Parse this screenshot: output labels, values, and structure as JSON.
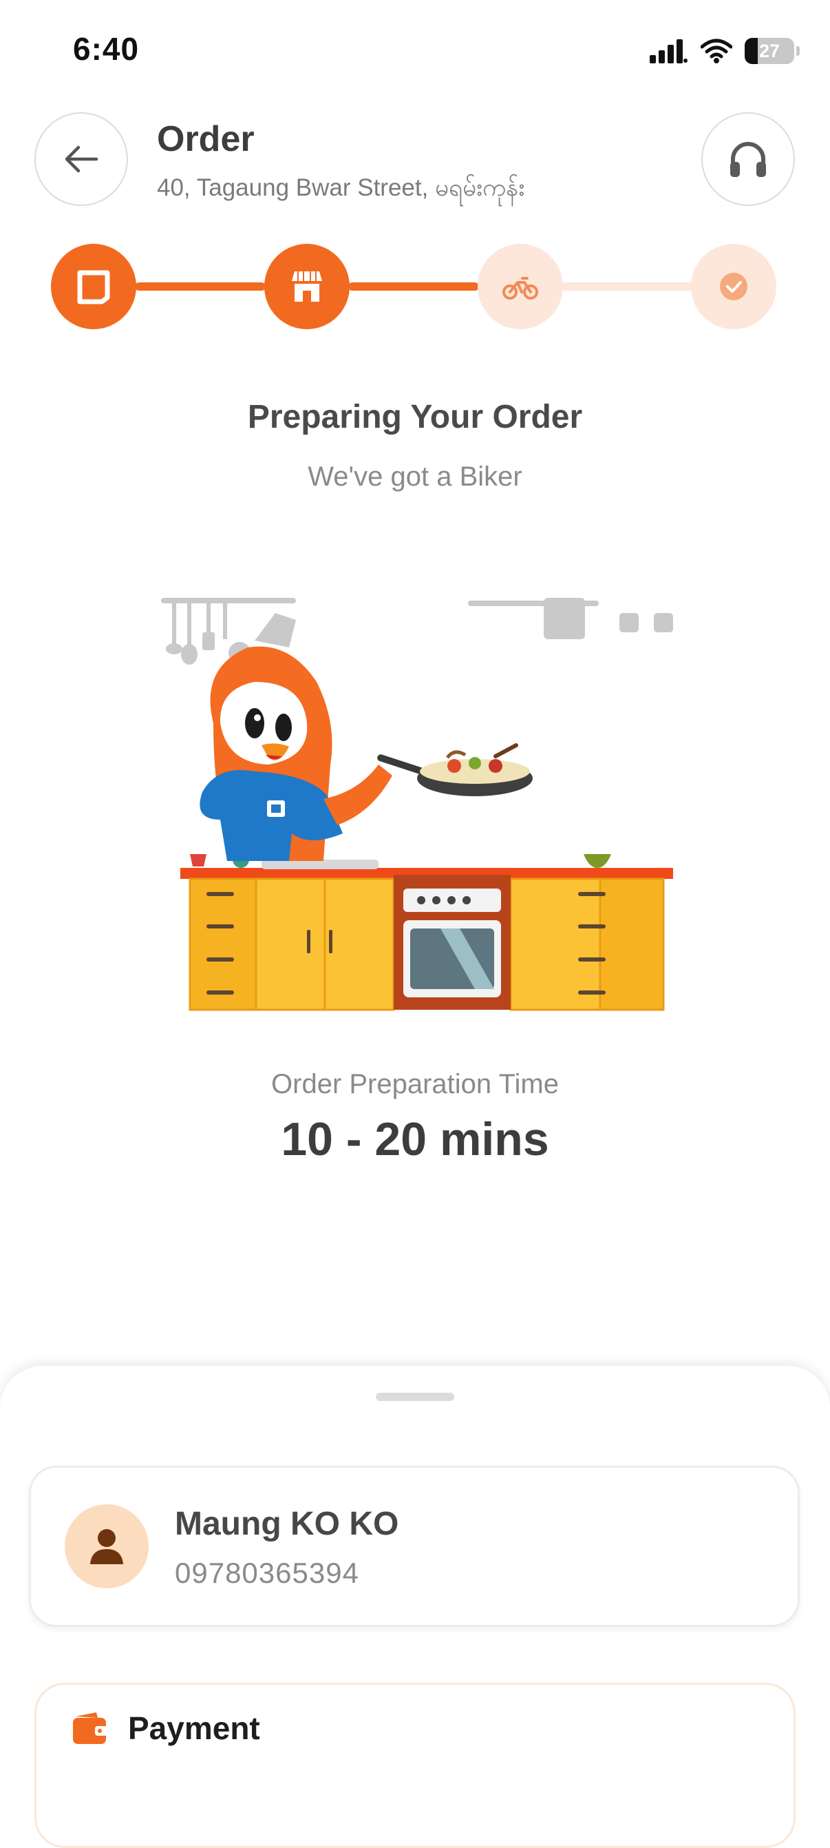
{
  "status_bar": {
    "time": "6:40",
    "battery": "27",
    "battery_level": 0.27
  },
  "header": {
    "title": "Order",
    "address": "40, Tagaung Bwar Street, မရမ်းကုန်း",
    "back_icon": "arrow-left-icon",
    "support_icon": "headphones-icon"
  },
  "progress": {
    "steps": [
      {
        "icon": "order-placed-icon",
        "state": "done"
      },
      {
        "icon": "store-icon",
        "state": "done"
      },
      {
        "icon": "bike-icon",
        "state": "pending"
      },
      {
        "icon": "check-icon",
        "state": "pending"
      }
    ],
    "colors": {
      "active": "#f26a1f",
      "inactive": "#fde7da"
    }
  },
  "stage": {
    "title": "Preparing Your Order",
    "subtitle": "We've got a Biker"
  },
  "preparation": {
    "label": "Order Preparation Time",
    "value": "10 - 20 mins"
  },
  "customer": {
    "name": "Maung KO KO",
    "phone": "09780365394",
    "avatar_icon": "person-icon"
  },
  "payment": {
    "label": "Payment",
    "icon": "wallet-icon"
  }
}
